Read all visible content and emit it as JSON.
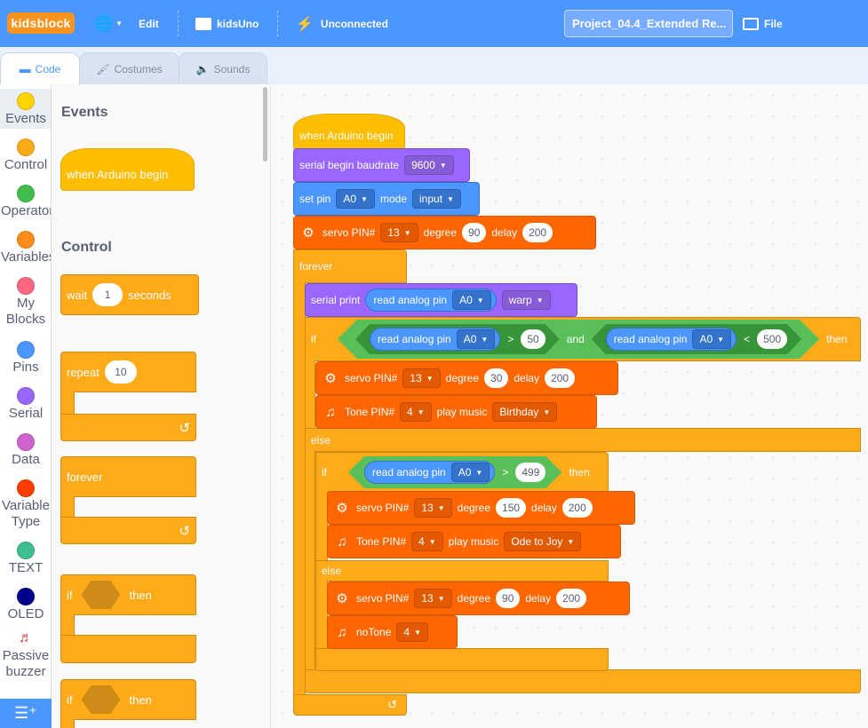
{
  "menubar": {
    "logo": "kidsblock",
    "language_icon": "globe-icon",
    "edit_label": "Edit",
    "board_label": "kidsUno",
    "connection_label": "Unconnected",
    "project_title": "Project_04.4_Extended Re...",
    "file_label": "File"
  },
  "tabs": [
    {
      "label": "Code",
      "icon": "code-icon",
      "active": true
    },
    {
      "label": "Costumes",
      "icon": "brush-icon"
    },
    {
      "label": "Sounds",
      "icon": "speaker-icon"
    }
  ],
  "categories": [
    {
      "label": "Events",
      "color": "#ffd500",
      "selected": true
    },
    {
      "label": "Control",
      "color": "#ffab19"
    },
    {
      "label": "Operator",
      "color": "#40bf4a"
    },
    {
      "label": "Variables",
      "color": "#ff8c1a"
    },
    {
      "label": "My Blocks",
      "color": "#ff6680"
    },
    {
      "label": "Pins",
      "color": "#4c97ff"
    },
    {
      "label": "Serial",
      "color": "#9966ff"
    },
    {
      "label": "Data",
      "color": "#cf63cf"
    },
    {
      "label": "Variable Type",
      "color": "#ff3d00"
    },
    {
      "label": "TEXT",
      "color": "#3fbf8f"
    },
    {
      "label": "OLED",
      "color": "#00008b"
    },
    {
      "label": "Passive buzzer",
      "icon": "music-note-icon"
    }
  ],
  "flyout": {
    "events_heading": "Events",
    "when_begin": "when Arduino begin",
    "control_heading": "Control",
    "wait_label": "wait",
    "wait_value": "1",
    "seconds_label": "seconds",
    "repeat_label": "repeat",
    "repeat_value": "10",
    "forever_label": "forever",
    "if_label": "if",
    "then_label": "then"
  },
  "script": {
    "hat": "when Arduino begin",
    "serial_begin": "serial begin baudrate",
    "baud": "9600",
    "set_pin": "set pin",
    "set_pin_value": "A0",
    "mode_label": "mode",
    "mode_value": "input",
    "servo1": {
      "label": "servo PIN#",
      "pin": "13",
      "degree_label": "degree",
      "degree": "90",
      "delay_label": "delay",
      "delay": "200"
    },
    "forever": "forever",
    "serial_print": "serial print",
    "read_analog": "read analog pin",
    "analog_pin": "A0",
    "warp": "warp",
    "if": "if",
    "gt": ">",
    "lt": "<",
    "v50": "50",
    "and": "and",
    "v500": "500",
    "then": "then",
    "servo2": {
      "label": "servo PIN#",
      "pin": "13",
      "degree_label": "degree",
      "degree": "30",
      "delay_label": "delay",
      "delay": "200"
    },
    "tone1": {
      "label": "Tone PIN#",
      "pin": "4",
      "play_label": "play music",
      "music": "Birthday"
    },
    "else": "else",
    "v499": "499",
    "servo3": {
      "label": "servo PIN#",
      "pin": "13",
      "degree_label": "degree",
      "degree": "150",
      "delay_label": "delay",
      "delay": "200"
    },
    "tone2": {
      "label": "Tone PIN#",
      "pin": "4",
      "play_label": "play music",
      "music": "Ode to Joy"
    },
    "servo4": {
      "label": "servo PIN#",
      "pin": "13",
      "degree_label": "degree",
      "degree": "90",
      "delay_label": "delay",
      "delay": "200"
    },
    "notone": {
      "label": "noTone",
      "pin": "4"
    }
  }
}
